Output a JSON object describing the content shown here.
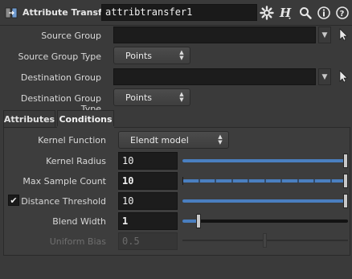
{
  "header": {
    "node_type": "Attribute Transfer",
    "node_name": "attribtransfer1",
    "icons": [
      "gear-icon",
      "houdini-help-icon",
      "magnify-icon",
      "info-icon",
      "help-icon"
    ]
  },
  "params": {
    "source_group": {
      "label": "Source Group",
      "value": ""
    },
    "source_group_type": {
      "label": "Source Group Type",
      "value": "Points"
    },
    "destination_group": {
      "label": "Destination Group",
      "value": ""
    },
    "destination_group_type": {
      "label": "Destination Group Type",
      "value": "Points"
    }
  },
  "tabs": [
    {
      "label": "Attributes",
      "active": false
    },
    {
      "label": "Conditions",
      "active": true
    }
  ],
  "conditions": {
    "kernel_function": {
      "label": "Kernel Function",
      "value": "Elendt model"
    },
    "kernel_radius": {
      "label": "Kernel Radius",
      "value": "10",
      "fraction": 1.0
    },
    "max_sample_count": {
      "label": "Max Sample Count",
      "value": "10",
      "fraction": 1.0
    },
    "distance_threshold": {
      "label": "Distance Threshold",
      "value": "10",
      "fraction": 1.0,
      "checked": true
    },
    "blend_width": {
      "label": "Blend Width",
      "value": "1",
      "fraction": 0.1
    },
    "uniform_bias": {
      "label": "Uniform Bias",
      "value": "0.5",
      "fraction": 0.5,
      "disabled": true
    }
  },
  "colors": {
    "background": "#3a3a3a",
    "field": "#1c1c1c",
    "slider_fill": "#4a7fc0"
  }
}
